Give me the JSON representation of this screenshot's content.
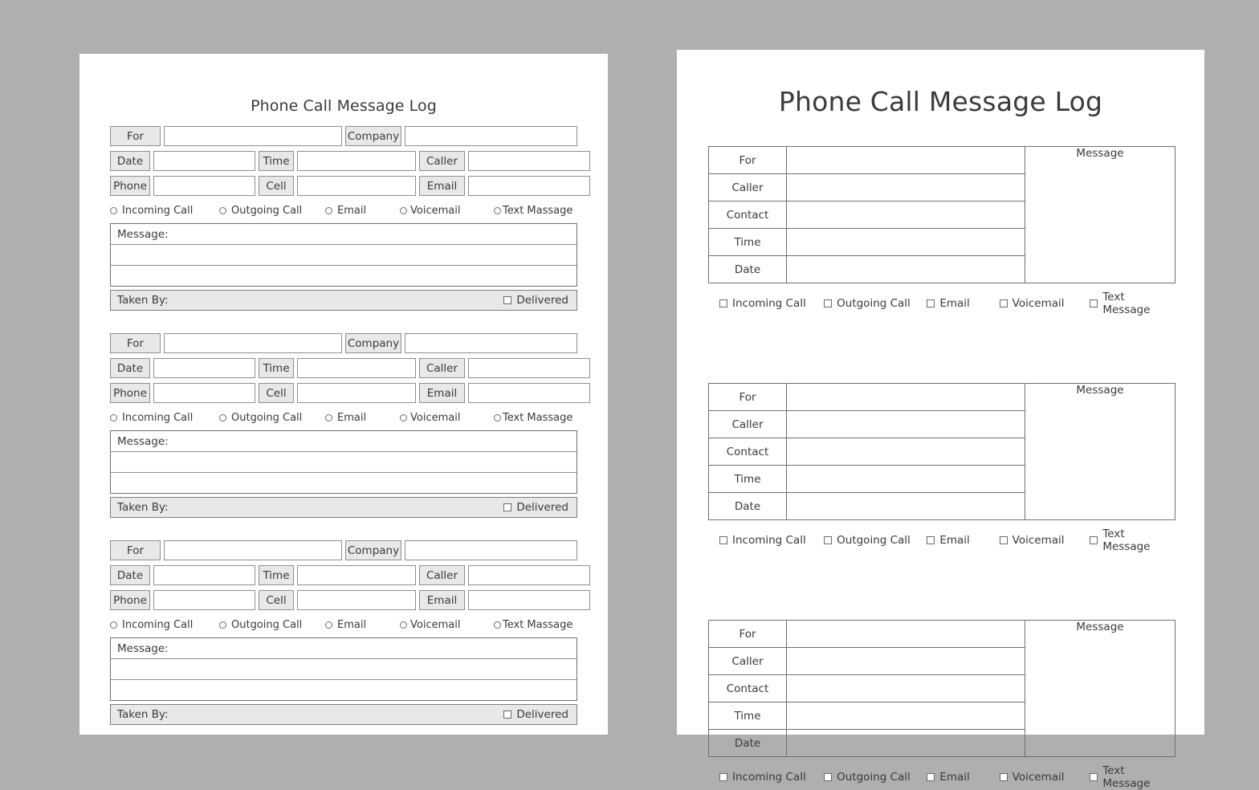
{
  "background_color": "#afafaf",
  "page_color": "#ffffff",
  "label_fill_color": "#e8e8e8",
  "border_color": "#6f6f6f",
  "text_color": "#3a3a3a",
  "left_page": {
    "title": "Phone Call Message Log",
    "labels": {
      "for": "For",
      "company": "Company",
      "date": "Date",
      "time": "Time",
      "caller": "Caller",
      "phone": "Phone",
      "cell": "Cell",
      "email": "Email"
    },
    "field_values": {
      "for": "",
      "company": "",
      "date": "",
      "time": "",
      "caller": "",
      "phone": "",
      "cell": "",
      "email": ""
    },
    "options": [
      {
        "label": "Incoming Call",
        "icon": "radio-icon",
        "checked": false
      },
      {
        "label": "Outgoing Call",
        "icon": "radio-icon",
        "checked": false
      },
      {
        "label": "Email",
        "icon": "radio-icon",
        "checked": false
      },
      {
        "label": "Voicemail",
        "icon": "radio-icon",
        "checked": false
      },
      {
        "label": "Text Massage",
        "icon": "radio-icon",
        "checked": false
      }
    ],
    "message_label": "Message:",
    "message_value": "",
    "message_blank_lines": 2,
    "taken_by_label": "Taken By:",
    "taken_by_value": "",
    "delivered_label": "Delivered",
    "delivered_checked": false,
    "block_count": 3
  },
  "right_page": {
    "title": "Phone Call Message Log",
    "rows": [
      {
        "label": "For",
        "value": ""
      },
      {
        "label": "Caller",
        "value": ""
      },
      {
        "label": "Contact",
        "value": ""
      },
      {
        "label": "Time",
        "value": ""
      },
      {
        "label": "Date",
        "value": ""
      }
    ],
    "message_label": "Message",
    "message_value": "",
    "options": [
      {
        "label": "Incoming Call",
        "icon": "checkbox-icon",
        "checked": false
      },
      {
        "label": "Outgoing Call",
        "icon": "checkbox-icon",
        "checked": false
      },
      {
        "label": "Email",
        "icon": "checkbox-icon",
        "checked": false
      },
      {
        "label": "Voicemail",
        "icon": "checkbox-icon",
        "checked": false
      },
      {
        "label": "Text Message",
        "icon": "checkbox-icon",
        "checked": false
      }
    ],
    "block_count": 3
  }
}
